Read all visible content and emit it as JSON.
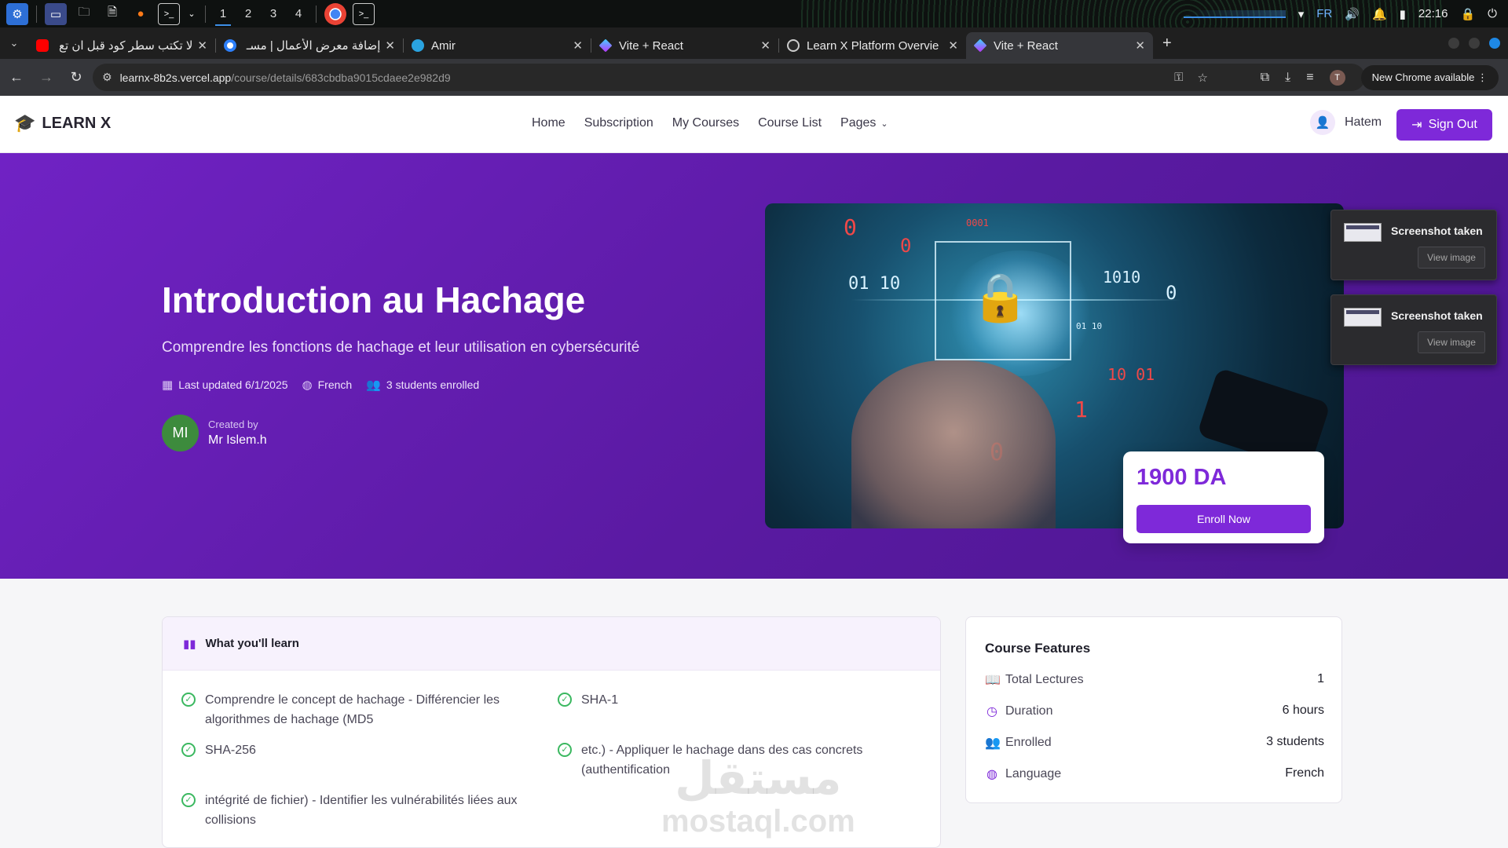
{
  "taskbar": {
    "workspaces": [
      "1",
      "2",
      "3",
      "4"
    ],
    "tray": {
      "language": "FR",
      "time": "22:16"
    }
  },
  "tabs": [
    {
      "title": "لا تكتب سطر كود قبل ان تع",
      "favicon_color": "#ff0000"
    },
    {
      "title": "إضافة معرض الأعمال | مسـ",
      "favicon_color": "#2d7ff9"
    },
    {
      "title": "Amir",
      "favicon_color": "#2aa3e0"
    },
    {
      "title": "Vite + React",
      "favicon_color": "#9b5cff"
    },
    {
      "title": "Learn X Platform Overvie",
      "favicon_color": "#cccccc"
    },
    {
      "title": "Vite + React",
      "favicon_color": "#9b5cff"
    }
  ],
  "browser": {
    "url_host": "learnx-8b2s.vercel.app",
    "url_path": "/course/details/683cbdba9015cdaee2e982d9",
    "profile_initial": "T",
    "new_chrome_label": "New Chrome available"
  },
  "site": {
    "brand": "LEARN X",
    "nav": [
      "Home",
      "Subscription",
      "My Courses",
      "Course List",
      "Pages"
    ],
    "user_name": "Hatem",
    "signout_label": "Sign Out",
    "accent": "#7e29d9"
  },
  "course": {
    "title": "Introduction au Hachage",
    "subtitle": "Comprendre les fonctions de hachage et leur utilisation en cybersécurité",
    "last_updated": "Last updated 6/1/2025",
    "language": "French",
    "students": "3 students enrolled",
    "created_by_label": "Created by",
    "creator_initials": "MI",
    "creator_name": "Mr Islem.h",
    "price": "1900 DA",
    "enroll_label": "Enroll Now"
  },
  "notifications": [
    {
      "title": "Screenshot taken",
      "action": "View image"
    },
    {
      "title": "Screenshot taken",
      "action": "View image"
    }
  ],
  "learn": {
    "heading": "What you'll learn",
    "items": [
      "Comprendre le concept de hachage - Différencier les algorithmes de hachage (MD5",
      "SHA-1",
      "SHA-256",
      "etc.) - Appliquer le hachage dans des cas concrets (authentification",
      "intégrité de fichier) - Identifier les vulnérabilités liées aux collisions"
    ]
  },
  "features": {
    "heading": "Course Features",
    "rows": [
      {
        "label": "Total Lectures",
        "value": "1",
        "icon": "book-icon"
      },
      {
        "label": "Duration",
        "value": "6 hours",
        "icon": "clock-icon"
      },
      {
        "label": "Enrolled",
        "value": "3 students",
        "icon": "users-icon"
      },
      {
        "label": "Language",
        "value": "French",
        "icon": "globe-icon"
      }
    ]
  },
  "watermark": {
    "arabic": "مستقل",
    "latin": "mostaql.com"
  }
}
